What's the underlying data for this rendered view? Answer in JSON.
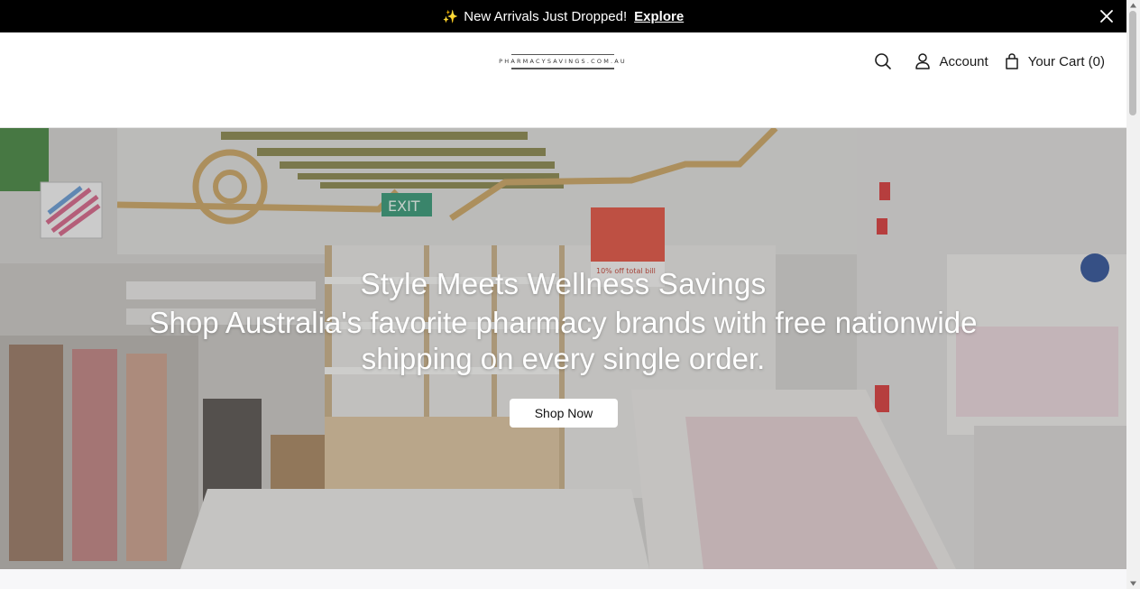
{
  "announcement": {
    "sparkle_icon": "sparkle-icon",
    "message": "New Arrivals Just Dropped!",
    "link_label": "Explore"
  },
  "header": {
    "logo_text": "PHARMACYSAVINGS.COM.AU",
    "account_label": "Account",
    "cart_label": "Your Cart (0)"
  },
  "hero": {
    "title": "Style Meets Wellness Savings",
    "subtitle": "Shop Australia's favorite pharmacy brands with free nationwide shipping on every single order.",
    "button_label": "Shop Now",
    "scene_sign": "EXIT",
    "scene_promo": "10% off total bill"
  },
  "colors": {
    "announcement_bg": "#000000",
    "header_bg": "#ffffff",
    "button_bg": "#ffffff",
    "text_dark": "#1a1a1a"
  }
}
